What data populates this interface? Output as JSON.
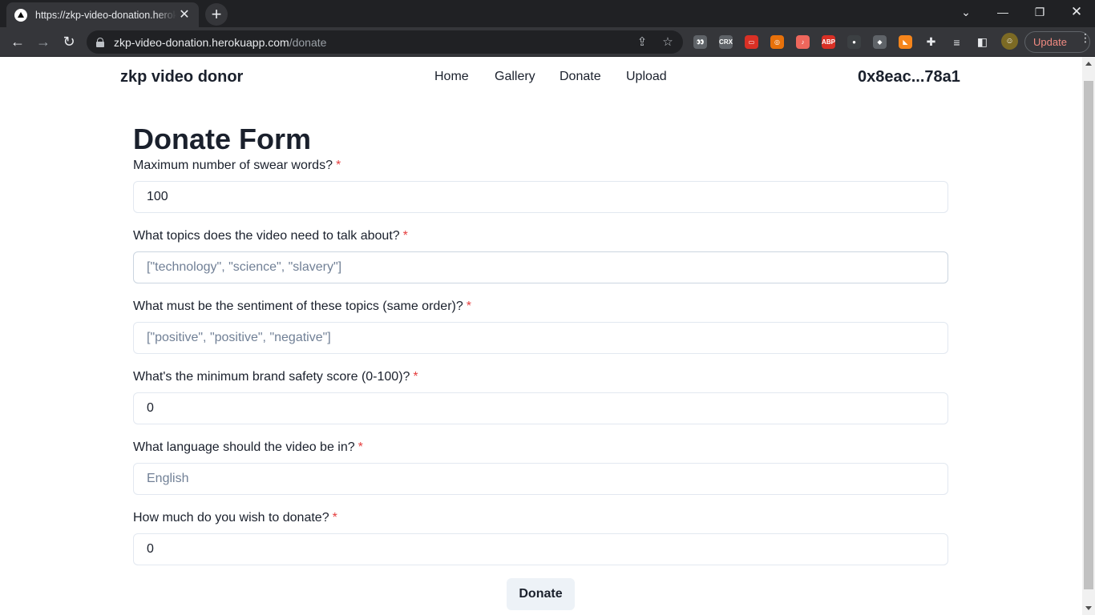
{
  "browser": {
    "tab_title": "https://zkp-video-donation.herokuapp.com/donate",
    "url_host": "zkp-video-donation.herokuapp.com",
    "url_path": "/donate",
    "update_label": "Update",
    "extensions": [
      {
        "icon": "eyes-extension-icon",
        "color": "#5f6368",
        "text": "👀"
      },
      {
        "icon": "crx-extension-icon",
        "color": "#5f6368",
        "text": "CRX"
      },
      {
        "icon": "red-extension-icon",
        "color": "#d93025",
        "text": "▭"
      },
      {
        "icon": "orange-extension-icon",
        "color": "#e8710a",
        "text": "◎"
      },
      {
        "icon": "speaker-extension-icon",
        "color": "#ee675c",
        "text": "♪"
      },
      {
        "icon": "adblock-extension-icon",
        "color": "#d93025",
        "text": "ABP"
      },
      {
        "icon": "dark-extension-icon",
        "color": "#3c4043",
        "text": "●"
      },
      {
        "icon": "puzzle-extension-icon",
        "color": "#5f6368",
        "text": "◆"
      },
      {
        "icon": "metamask-fox-icon",
        "color": "#f6851b",
        "text": "◣"
      }
    ]
  },
  "site": {
    "brand": "zkp video donor",
    "nav": [
      "Home",
      "Gallery",
      "Donate",
      "Upload"
    ],
    "wallet": "0x8eac...78a1"
  },
  "form": {
    "title": "Donate Form",
    "fields": [
      {
        "label": "Maximum number of swear words?",
        "value": "100",
        "placeholder": ""
      },
      {
        "label": "What topics does the video need to talk about?",
        "value": "",
        "placeholder": "[\"technology\", \"science\", \"slavery\"]"
      },
      {
        "label": "What must be the sentiment of these topics (same order)?",
        "value": "",
        "placeholder": "[\"positive\", \"positive\", \"negative\"]"
      },
      {
        "label": "What's the minimum brand safety score (0-100)?",
        "value": "0",
        "placeholder": ""
      },
      {
        "label": "What language should the video be in?",
        "value": "",
        "placeholder": "English"
      },
      {
        "label": "How much do you wish to donate?",
        "value": "0",
        "placeholder": ""
      }
    ],
    "required_mark": "*",
    "submit_label": "Donate"
  }
}
